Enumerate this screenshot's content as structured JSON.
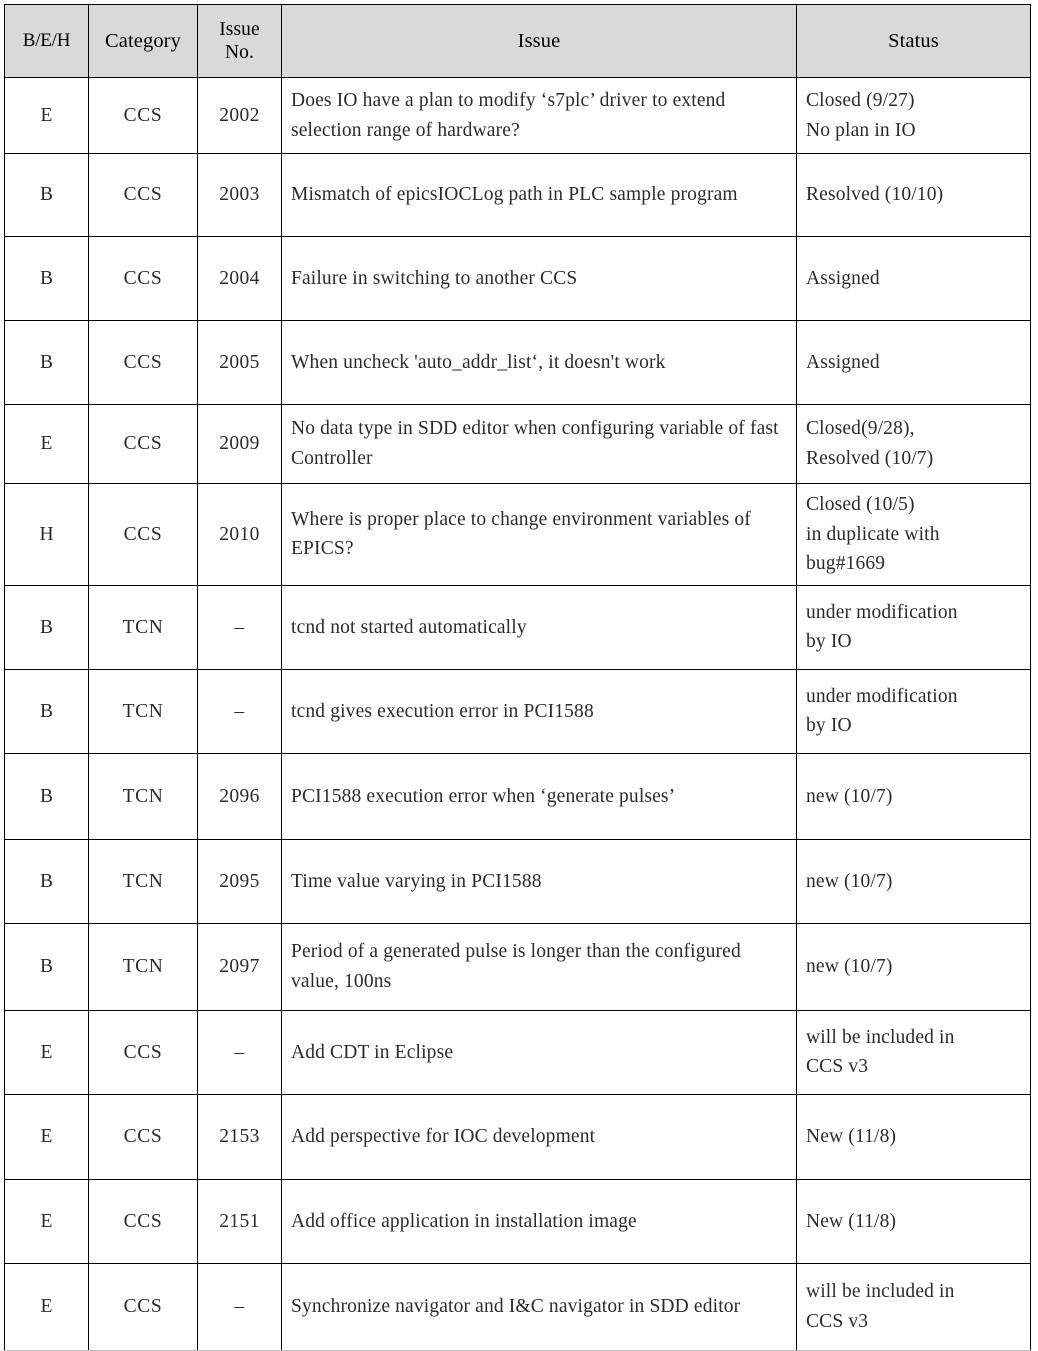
{
  "table": {
    "name": "issue-tracking-table",
    "columns": [
      {
        "key": "beh",
        "label": "B/E/H"
      },
      {
        "key": "category",
        "label": "Category"
      },
      {
        "key": "issue_no",
        "label": "Issue\nNo."
      },
      {
        "key": "issue",
        "label": "Issue"
      },
      {
        "key": "status",
        "label": "Status"
      }
    ],
    "header_background": "#d9d9d9",
    "border_color": "#000000",
    "rows": [
      {
        "beh": "E",
        "category": "CCS",
        "issue_no": "2002",
        "issue": "Does IO have a plan to modify ‘s7plc’ driver to extend selection range of hardware?",
        "status": "Closed (9/27)\nNo plan in IO"
      },
      {
        "beh": "B",
        "category": "CCS",
        "issue_no": "2003",
        "issue": "Mismatch of epicsIOCLog path in PLC sample program",
        "status": "Resolved (10/10)"
      },
      {
        "beh": "B",
        "category": "CCS",
        "issue_no": "2004",
        "issue": "Failure in switching to another CCS",
        "status": "Assigned"
      },
      {
        "beh": "B",
        "category": "CCS",
        "issue_no": "2005",
        "issue": "When uncheck 'auto_addr_list‘, it doesn't work",
        "status": "Assigned"
      },
      {
        "beh": "E",
        "category": "CCS",
        "issue_no": "2009",
        "issue": "No data type in SDD editor when configuring variable of fast Controller",
        "status": "Closed(9/28),\nResolved (10/7)"
      },
      {
        "beh": "H",
        "category": "CCS",
        "issue_no": "2010",
        "issue": "Where is proper place to change environment variables of EPICS?",
        "status": "Closed (10/5)\nin duplicate with\nbug#1669"
      },
      {
        "beh": "B",
        "category": "TCN",
        "issue_no": "–",
        "issue": "tcnd not started automatically",
        "status": "under modification\nby IO"
      },
      {
        "beh": "B",
        "category": "TCN",
        "issue_no": "–",
        "issue": "tcnd gives execution error in PCI1588",
        "status": "under modification\nby IO"
      },
      {
        "beh": "B",
        "category": "TCN",
        "issue_no": "2096",
        "issue": "PCI1588 execution error when ‘generate pulses’",
        "status": "new (10/7)"
      },
      {
        "beh": "B",
        "category": "TCN",
        "issue_no": "2095",
        "issue": "Time value varying in PCI1588",
        "status": "new (10/7)"
      },
      {
        "beh": "B",
        "category": "TCN",
        "issue_no": "2097",
        "issue": "Period of a generated pulse is longer than the configured value, 100ns",
        "status": "new (10/7)"
      },
      {
        "beh": "E",
        "category": "CCS",
        "issue_no": "–",
        "issue": "Add CDT in Eclipse",
        "status": "will be included in\nCCS v3"
      },
      {
        "beh": "E",
        "category": "CCS",
        "issue_no": "2153",
        "issue": "Add perspective for IOC development",
        "status": "New (11/8)"
      },
      {
        "beh": "E",
        "category": "CCS",
        "issue_no": "2151",
        "issue": "Add office application in installation image",
        "status": "New (11/8)"
      },
      {
        "beh": "E",
        "category": "CCS",
        "issue_no": "–",
        "issue": "Synchronize navigator and I&C navigator in SDD editor",
        "status": "will be included in\nCCS v3"
      }
    ]
  }
}
